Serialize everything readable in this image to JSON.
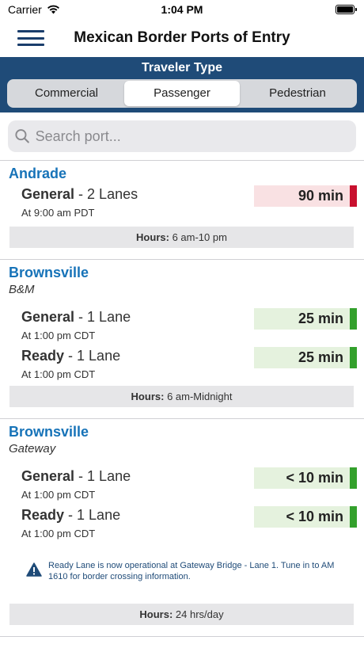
{
  "status_bar": {
    "carrier": "Carrier",
    "time": "1:04 PM"
  },
  "nav": {
    "title": "Mexican Border Ports of Entry"
  },
  "traveler": {
    "title": "Traveler Type",
    "options": [
      "Commercial",
      "Passenger",
      "Pedestrian"
    ],
    "selected": "Passenger"
  },
  "search": {
    "placeholder": "Search port..."
  },
  "hours_label": "Hours:",
  "colors": {
    "accent_blue": "#1773b8",
    "header_blue": "#1f4b78",
    "delay_red": "#c8102e",
    "ok_green": "#33a02c"
  },
  "ports": [
    {
      "name": "Andrade",
      "crossing": "",
      "lanes": [
        {
          "type": "General",
          "lanes": "2 Lanes",
          "time": "At 9:00 am PDT",
          "wait": "90 min",
          "status": "red"
        }
      ],
      "hours": "6 am-10 pm"
    },
    {
      "name": "Brownsville",
      "crossing": "B&M",
      "lanes": [
        {
          "type": "General",
          "lanes": "1 Lane",
          "time": "At 1:00 pm CDT",
          "wait": "25 min",
          "status": "green"
        },
        {
          "type": "Ready",
          "lanes": "1 Lane",
          "time": "At 1:00 pm CDT",
          "wait": "25 min",
          "status": "green"
        }
      ],
      "hours": "6 am-Midnight"
    },
    {
      "name": "Brownsville",
      "crossing": "Gateway",
      "lanes": [
        {
          "type": "General",
          "lanes": "1 Lane",
          "time": "At 1:00 pm CDT",
          "wait": "< 10 min",
          "status": "green"
        },
        {
          "type": "Ready",
          "lanes": "1 Lane",
          "time": "At 1:00 pm CDT",
          "wait": "< 10 min",
          "status": "green"
        }
      ],
      "notice": "Ready Lane is now operational at Gateway Bridge - Lane 1.  Tune in to AM 1610 for border crossing information.",
      "hours": "24 hrs/day"
    }
  ]
}
